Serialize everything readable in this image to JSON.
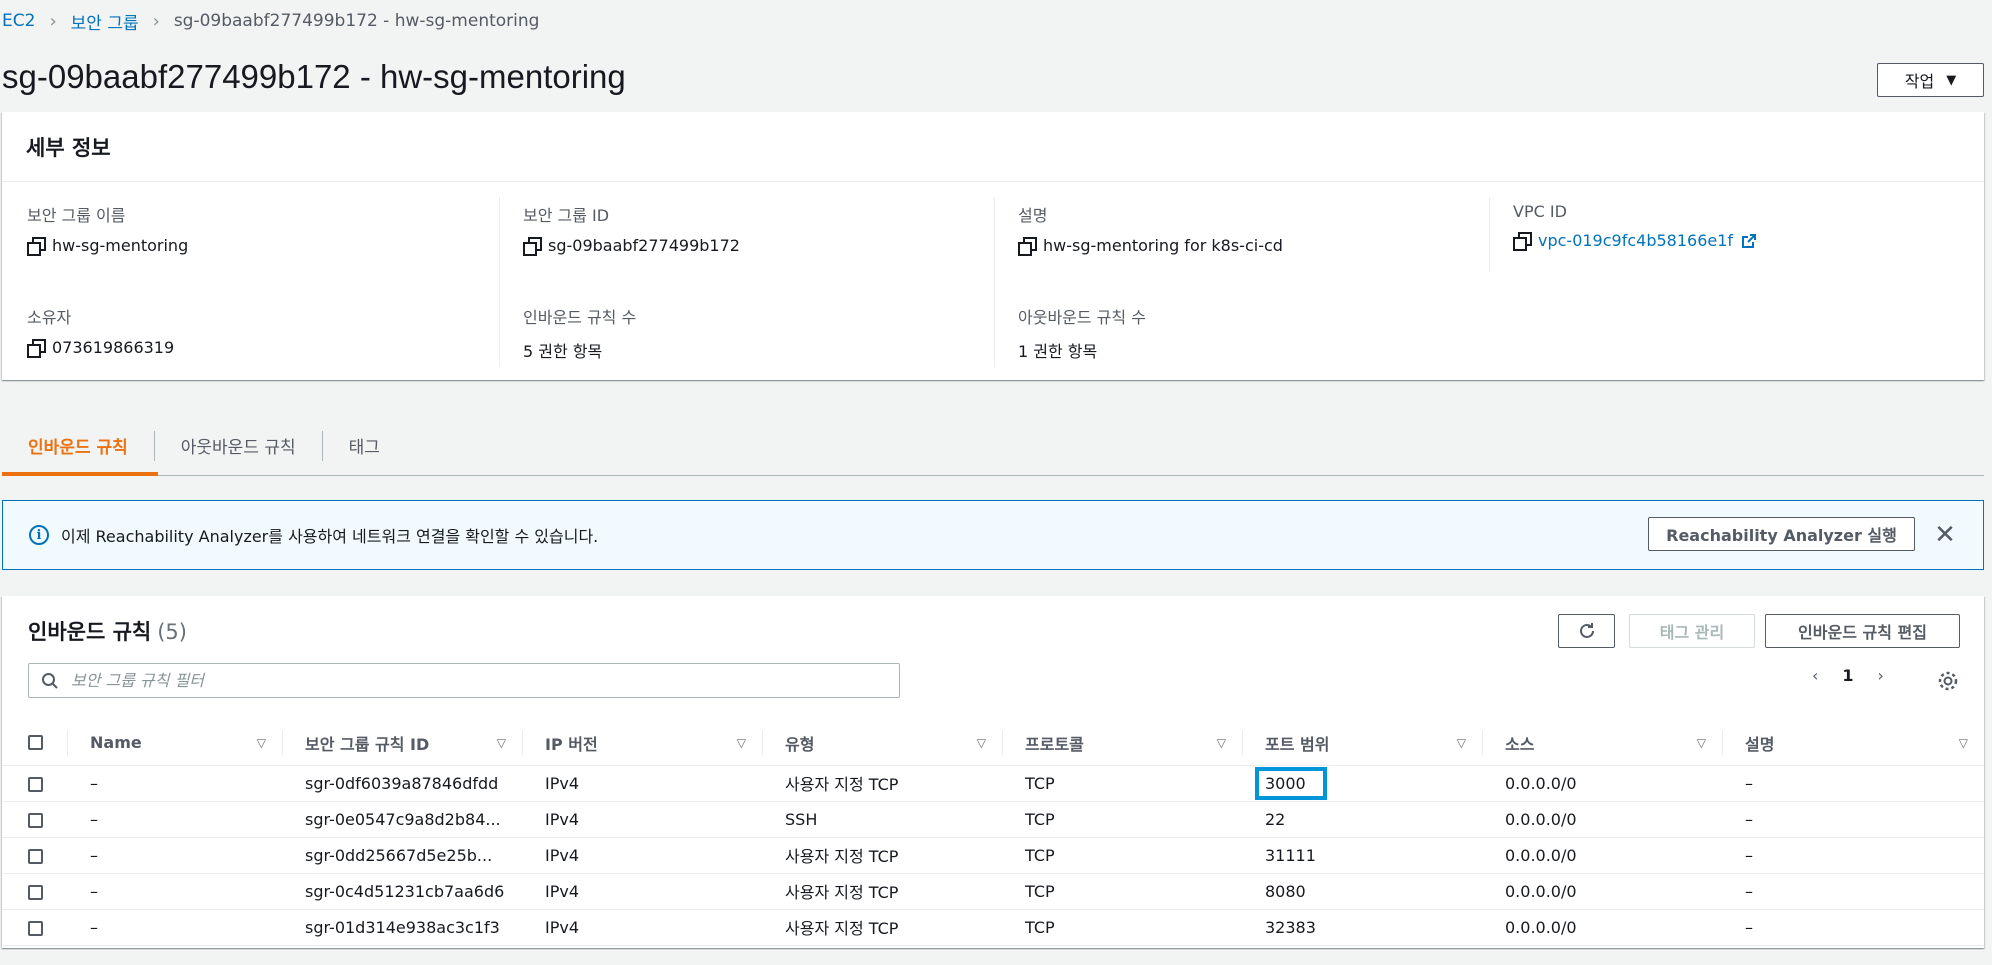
{
  "breadcrumb": {
    "root": "EC2",
    "parent": "보안 그룹",
    "current": "sg-09baabf277499b172 - hw-sg-mentoring"
  },
  "page": {
    "title": "sg-09baabf277499b172 - hw-sg-mentoring",
    "actions_label": "작업"
  },
  "details": {
    "header": "세부 정보",
    "sg_name": {
      "label": "보안 그룹 이름",
      "value": "hw-sg-mentoring"
    },
    "sg_id": {
      "label": "보안 그룹 ID",
      "value": "sg-09baabf277499b172"
    },
    "description": {
      "label": "설명",
      "value": "hw-sg-mentoring for k8s-ci-cd"
    },
    "vpc_id": {
      "label": "VPC ID",
      "value": "vpc-019c9fc4b58166e1f"
    },
    "owner": {
      "label": "소유자",
      "value": "073619866319"
    },
    "inbound_count": {
      "label": "인바운드 규칙 수",
      "value": "5 권한 항목"
    },
    "outbound_count": {
      "label": "아웃바운드 규칙 수",
      "value": "1 권한 항목"
    }
  },
  "tabs": [
    {
      "label": "인바운드 규칙"
    },
    {
      "label": "아웃바운드 규칙"
    },
    {
      "label": "태그"
    }
  ],
  "banner": {
    "text": "이제 Reachability Analyzer를 사용하여 네트워크 연결을 확인할 수 있습니다.",
    "button_label": "Reachability Analyzer 실행"
  },
  "rules": {
    "title": "인바운드 규칙",
    "count": "(5)",
    "manage_tags_label": "태그 관리",
    "edit_label": "인바운드 규칙 편집",
    "filter_placeholder": "보안 그룹 규칙 필터",
    "page": "1",
    "columns": [
      "Name",
      "보안 그룹 규칙 ID",
      "IP 버전",
      "유형",
      "프로토콜",
      "포트 범위",
      "소스",
      "설명"
    ],
    "rows": [
      {
        "name": "–",
        "rule_id": "sgr-0df6039a87846dfdd",
        "ip": "IPv4",
        "type": "사용자 지정 TCP",
        "protocol": "TCP",
        "port": "3000",
        "source": "0.0.0.0/0",
        "desc": "–"
      },
      {
        "name": "–",
        "rule_id": "sgr-0e0547c9a8d2b84...",
        "ip": "IPv4",
        "type": "SSH",
        "protocol": "TCP",
        "port": "22",
        "source": "0.0.0.0/0",
        "desc": "–"
      },
      {
        "name": "–",
        "rule_id": "sgr-0dd25667d5e25b...",
        "ip": "IPv4",
        "type": "사용자 지정 TCP",
        "protocol": "TCP",
        "port": "31111",
        "source": "0.0.0.0/0",
        "desc": "–"
      },
      {
        "name": "–",
        "rule_id": "sgr-0c4d51231cb7aa6d6",
        "ip": "IPv4",
        "type": "사용자 지정 TCP",
        "protocol": "TCP",
        "port": "8080",
        "source": "0.0.0.0/0",
        "desc": "–"
      },
      {
        "name": "–",
        "rule_id": "sgr-01d314e938ac3c1f3",
        "ip": "IPv4",
        "type": "사용자 지정 TCP",
        "protocol": "TCP",
        "port": "32383",
        "source": "0.0.0.0/0",
        "desc": "–"
      }
    ]
  },
  "colors": {
    "link": "#0073bb",
    "active_tab": "#ec7211",
    "highlight": "#0094d8"
  }
}
